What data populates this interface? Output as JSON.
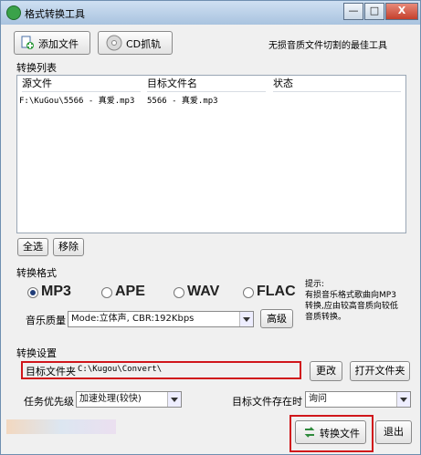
{
  "window": {
    "title": "格式转换工具",
    "min": "—",
    "max": "□",
    "close": "X"
  },
  "toolbar": {
    "add_file": "添加文件",
    "cd_rip": "CD抓轨",
    "slogan": "无损音质文件切割的最佳工具"
  },
  "list": {
    "section_label": "转换列表",
    "columns": [
      "源文件",
      "目标文件名",
      "状态"
    ],
    "rows": [
      {
        "source": "F:\\KuGou\\5566 - 真爱.mp3",
        "target": "5566 - 真爱.mp3",
        "status": ""
      }
    ],
    "select_all": "全选",
    "remove": "移除"
  },
  "format": {
    "section_label": "转换格式",
    "options": [
      "MP3",
      "APE",
      "WAV",
      "FLAC"
    ],
    "selected": "MP3",
    "tip": "提示:\n有损音乐格式歌曲向MP3\n转换,应由较高音质向较低\n音质转换。",
    "quality_label": "音乐质量",
    "quality_value": "Mode:立体声, CBR:192Kbps",
    "advanced": "高级"
  },
  "settings": {
    "section_label": "转换设置",
    "folder_label": "目标文件夹",
    "folder_value": "C:\\Kugou\\Convert\\",
    "change": "更改",
    "open_folder": "打开文件夹",
    "priority_label": "任务优先级",
    "priority_value": "加速处理(较快)",
    "exists_label": "目标文件存在时",
    "exists_value": "询问"
  },
  "actions": {
    "convert": "转换文件",
    "exit": "退出"
  },
  "colors": {
    "highlight": "#d0161b"
  }
}
